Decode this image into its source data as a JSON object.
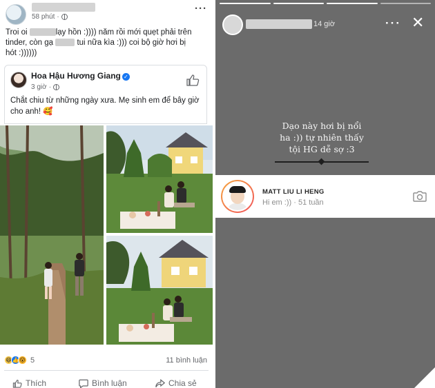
{
  "post": {
    "time": "58 phút",
    "more_icon": "more-horizontal-icon",
    "text_line1_a": "Troi oi",
    "text_line1_b": "lạy hồn :))))  năm rồi mới quẹt phải trên",
    "text_line2_a": "tinder, còn gạ",
    "text_line2_b": "tui nữa kìa :))) coi bộ giờ hơi bị",
    "text_line3": "hót :))))))",
    "shared": {
      "author": "Hoa Hậu Hương Giang",
      "time": "3 giờ",
      "text": "Chắt chiu từ những ngày xưa. Mẹ sinh em để bây giờ cho anh! 🥰"
    },
    "reaction_count": "5",
    "comments": "11 bình luận",
    "actions": {
      "like": "Thích",
      "comment": "Bình luận",
      "share": "Chia sẻ"
    }
  },
  "story": {
    "time": "14 giờ",
    "more_icon": "more-horizontal-icon",
    "close_icon": "close-icon",
    "text_line1": "Dạo này hơi bị nổi",
    "text_line2": "ha :)) tự nhiên thấy",
    "text_line3": "tội HG dễ sợ :3",
    "reply": {
      "name": "MATT LIU LI HENG",
      "message": "Hi em :))",
      "age": "51 tuần"
    }
  },
  "colors": {
    "facebook_blue": "#1877f2",
    "story_background": "#6b6b6b",
    "secondary_text": "#65676b"
  }
}
